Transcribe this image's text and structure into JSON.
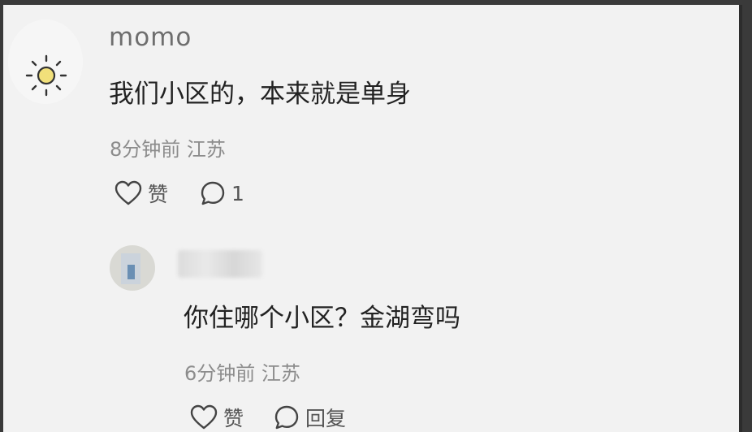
{
  "comment": {
    "username": "momo",
    "text": "我们小区的，本来就是单身",
    "time": "8分钟前",
    "location": "江苏",
    "like_label": "赞",
    "reply_count": "1",
    "avatar_icon": "sun-icon"
  },
  "reply": {
    "text": "你住哪个小区？金湖弯吗",
    "time": "6分钟前",
    "location": "江苏",
    "like_label": "赞",
    "reply_label": "回复"
  },
  "colors": {
    "background": "#f2f2f2",
    "text": "#222222",
    "meta": "#8c8c8c",
    "sun": "#f1e07a"
  }
}
